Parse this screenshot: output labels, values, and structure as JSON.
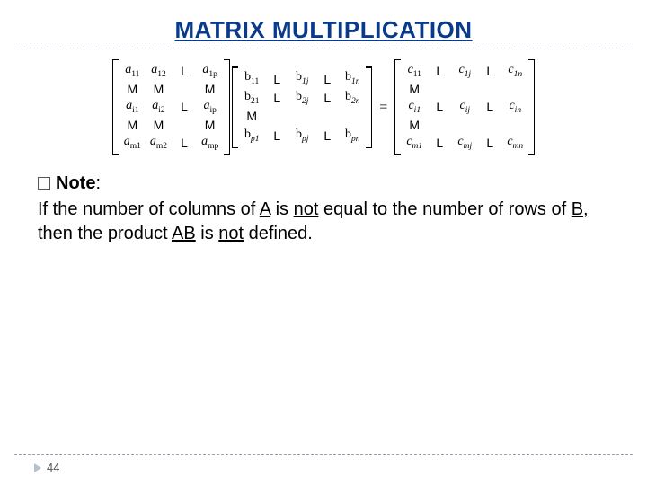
{
  "title": "MATRIX MULTIPLICATION",
  "note": {
    "label": "Note",
    "colon": ":",
    "body_parts": {
      "p1": "If the number of columns of ",
      "A": "A",
      "p2": " is ",
      "not": "not",
      "p3": " equal to the number of rows of ",
      "B": "B",
      "p4": ", then the product ",
      "AB": "AB",
      "p5": " is ",
      "not2": "not",
      "p6": " defined."
    }
  },
  "equation": {
    "eq": "=",
    "L": "L",
    "M": "M",
    "A": {
      "r1c1": "a",
      "r1c1s": "11",
      "r1c2": "a",
      "r1c2s": "12",
      "r1c4": "a",
      "r1c4s": "1p",
      "r3c1": "a",
      "r3c1s": "i1",
      "r3c2": "a",
      "r3c2s": "i2",
      "r3c4": "a",
      "r3c4s": "ip",
      "r5c1": "a",
      "r5c1s": "m1",
      "r5c2": "a",
      "r5c2s": "m2",
      "r5c4": "a",
      "r5c4s": "mp"
    },
    "B": {
      "r1c1": "b",
      "r1c1s": "11",
      "r1c3": "b",
      "r1c3s": "1j",
      "r1c5": "b",
      "r1c5s": "1n",
      "r2c1": "b",
      "r2c1s": "21",
      "r2c3": "b",
      "r2c3s": "2j",
      "r2c5": "b",
      "r2c5s": "2n",
      "r5c1": "b",
      "r5c1s": "p1",
      "r5c3": "b",
      "r5c3s": "pj",
      "r5c5": "b",
      "r5c5s": "pn"
    },
    "C": {
      "r1c1": "c",
      "r1c1s": "11",
      "r1c3": "c",
      "r1c3s": "1j",
      "r1c5": "c",
      "r1c5s": "1n",
      "r3c1": "c",
      "r3c1s": "i1",
      "r3c3": "c",
      "r3c3s": "ij",
      "r3c5": "c",
      "r3c5s": "in",
      "r5c1": "c",
      "r5c1s": "m1",
      "r5c3": "c",
      "r5c3s": "mj",
      "r5c5": "c",
      "r5c5s": "mn"
    }
  },
  "page": "44"
}
